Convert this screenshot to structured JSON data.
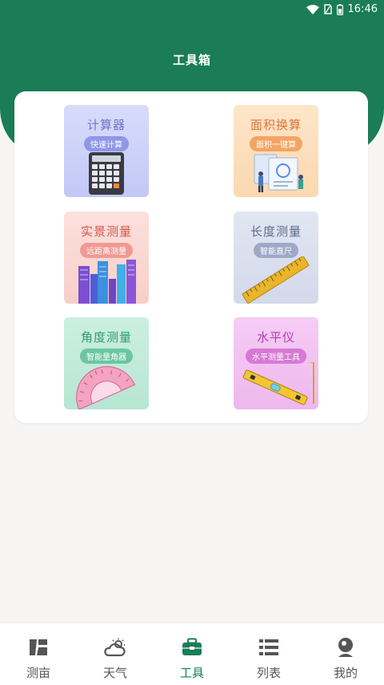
{
  "status_bar": {
    "time": "16:46"
  },
  "header": {
    "title": "工具箱"
  },
  "tools": [
    {
      "title": "计算器",
      "subtitle": "快速计算",
      "icon": "calculator-icon"
    },
    {
      "title": "面积换算",
      "subtitle": "面积一键算",
      "icon": "area-conversion-icon"
    },
    {
      "title": "实景测量",
      "subtitle": "远距离测量",
      "icon": "buildings-icon"
    },
    {
      "title": "长度测量",
      "subtitle": "智能直尺",
      "icon": "ruler-icon"
    },
    {
      "title": "角度测量",
      "subtitle": "智能量角器",
      "icon": "protractor-icon"
    },
    {
      "title": "水平仪",
      "subtitle": "水平测量工具",
      "icon": "spirit-level-icon"
    }
  ],
  "nav": {
    "items": [
      {
        "label": "测亩",
        "icon": "map-icon"
      },
      {
        "label": "天气",
        "icon": "weather-icon"
      },
      {
        "label": "工具",
        "icon": "toolbox-icon"
      },
      {
        "label": "列表",
        "icon": "list-icon"
      },
      {
        "label": "我的",
        "icon": "profile-icon"
      }
    ],
    "active": "工具"
  },
  "colors": {
    "brand": "#1a7d57",
    "background": "#f6f5f3",
    "nav_inactive": "#555555"
  }
}
